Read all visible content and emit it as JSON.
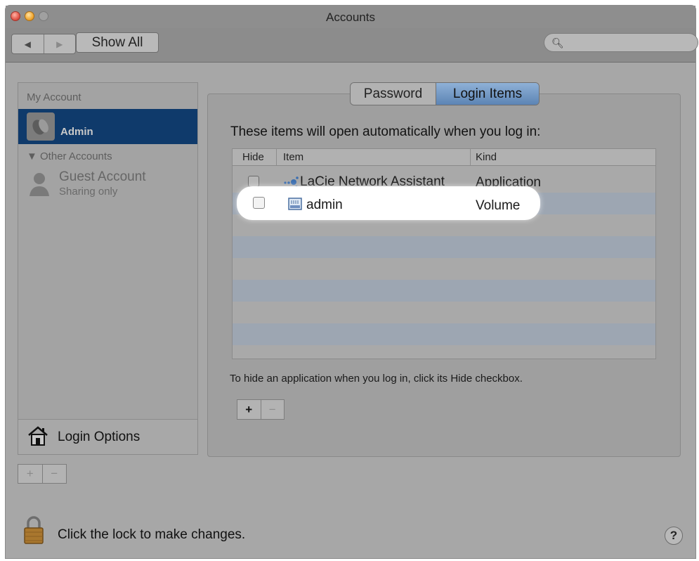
{
  "window": {
    "title": "Accounts"
  },
  "toolbar": {
    "show_all": "Show All",
    "back_icon": "back-arrow-icon",
    "forward_icon": "forward-arrow-icon",
    "search_placeholder": ""
  },
  "sidebar": {
    "section_my_account": "My Account",
    "current_user": "Admin",
    "section_other": "▼ Other Accounts",
    "guest_name": "Guest Account",
    "guest_sub": "Sharing only",
    "footer_label": "Login Options"
  },
  "tabs": [
    {
      "label": "Password"
    },
    {
      "label": "Login Items",
      "selected": true
    }
  ],
  "login_items": {
    "intro": "These items will open automatically when you log in:",
    "columns": [
      "Hide",
      "Item",
      "Kind"
    ],
    "rows": [
      {
        "item": "LaCie Network Assistant",
        "kind": "Application",
        "hidden": false
      },
      {
        "item": "admin",
        "kind": "Volume",
        "hidden": false
      }
    ],
    "hint": "To hide an application when you log in, click its Hide checkbox.",
    "add": "+",
    "remove": "−"
  },
  "bottom": {
    "lock_text": "Click the lock to make changes.",
    "help": "?",
    "add": "+",
    "remove": "−"
  },
  "colors": {
    "selection": "#0f3a6b",
    "tab_active": "#6b8fbe",
    "highlight": "#ffffff"
  }
}
